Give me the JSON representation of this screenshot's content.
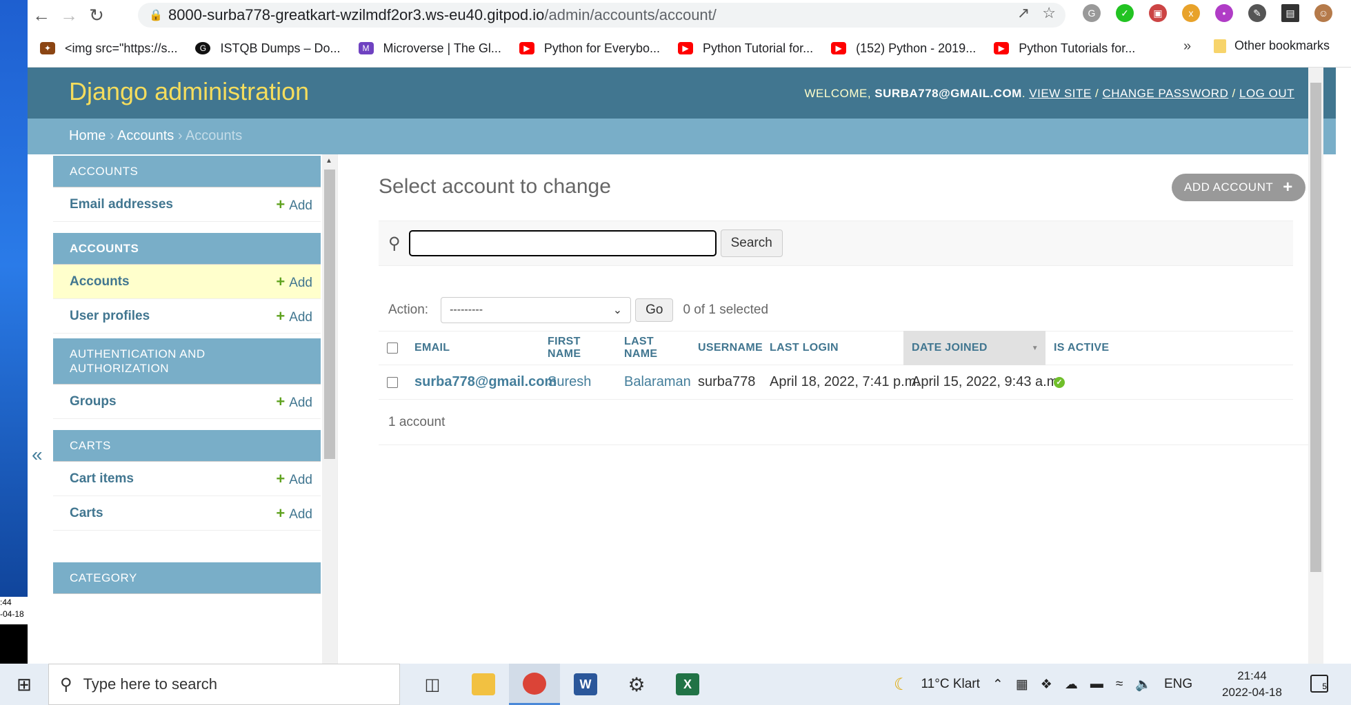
{
  "desktop": {
    "clock_time": ":44",
    "clock_date": "-04-18"
  },
  "browser": {
    "url_host": "8000-surba778-greatkart-wzilmdf2or3.ws-eu40.gitpod.io",
    "url_path": "/admin/accounts/account/",
    "bookmarks": [
      {
        "label": "<img src=\"https://s...",
        "icon": "bird-icon",
        "color": "#8b4513"
      },
      {
        "label": "ISTQB Dumps – Do...",
        "icon": "g-icon",
        "color": "#111111"
      },
      {
        "label": "Microverse | The Gl...",
        "icon": "microverse-icon",
        "color": "#6f42c1"
      },
      {
        "label": "Python for Everybo...",
        "icon": "youtube-icon",
        "color": "#ff0000"
      },
      {
        "label": "Python Tutorial for...",
        "icon": "youtube-icon",
        "color": "#ff0000"
      },
      {
        "label": "(152) Python - 2019...",
        "icon": "youtube-icon",
        "color": "#ff0000"
      },
      {
        "label": "Python Tutorials for...",
        "icon": "youtube-icon",
        "color": "#ff0000"
      }
    ],
    "bookmarks_more": "»",
    "other_bookmarks": "Other bookmarks"
  },
  "admin": {
    "brand": "Django administration",
    "welcome": "Welcome,",
    "user": "surba778@gmail.com",
    "view_site": "View site",
    "change_password": "Change password",
    "log_out": "Log out",
    "breadcrumb": {
      "home": "Home",
      "app": "Accounts",
      "current": "Accounts"
    },
    "collapse": "«",
    "add_label": "Add",
    "modules": [
      {
        "title": "ACCOUNTS",
        "rows": [
          "Email addresses"
        ]
      },
      {
        "title": "ACCOUNTS",
        "rows": [
          "Accounts",
          "User profiles"
        ]
      },
      {
        "title": "AUTHENTICATION AND AUTHORIZATION",
        "rows": [
          "Groups"
        ]
      },
      {
        "title": "CARTS",
        "rows": [
          "Cart items",
          "Carts"
        ]
      },
      {
        "title": "CATEGORY",
        "rows": []
      }
    ],
    "page_title": "Select account to change",
    "add_account": "ADD ACCOUNT",
    "search_value": "",
    "search_button": "Search",
    "action_label": "Action:",
    "action_selected": "---------",
    "go_button": "Go",
    "selection_count": "0 of 1 selected",
    "columns": [
      "EMAIL",
      "FIRST NAME",
      "LAST NAME",
      "USERNAME",
      "LAST LOGIN",
      "DATE JOINED",
      "IS ACTIVE"
    ],
    "rows": [
      {
        "email": "surba778@gmail.com",
        "first_name": "Suresh",
        "last_name": "Balaraman",
        "username": "surba778",
        "last_login": "April 18, 2022, 7:41 p.m.",
        "date_joined": "April 15, 2022, 9:43 a.m.",
        "is_active": true
      }
    ],
    "paginator": "1 account"
  },
  "taskbar": {
    "search_placeholder": "Type here to search",
    "weather": "11°C  Klart",
    "language": "ENG",
    "time": "21:44",
    "date": "2022-04-18",
    "notifications": "5"
  }
}
